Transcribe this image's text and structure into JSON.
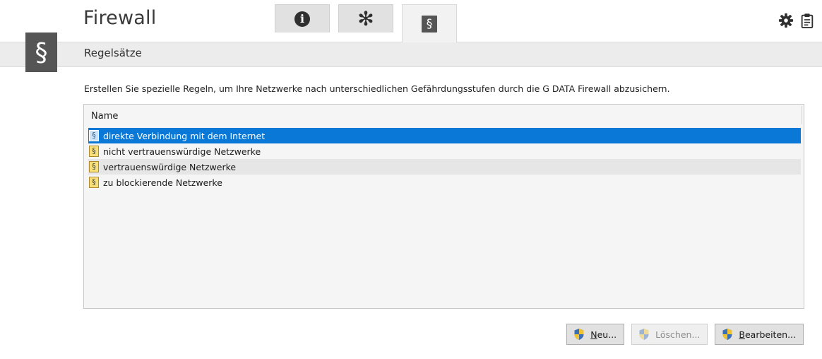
{
  "header": {
    "title": "Firewall",
    "tabs": [
      {
        "name": "info",
        "icon": "info-icon"
      },
      {
        "name": "settings",
        "icon": "asterisk-icon"
      },
      {
        "name": "rulesets",
        "icon": "paragraph-icon",
        "active": true
      }
    ],
    "top_icons": [
      "gear-icon",
      "clipboard-icon"
    ]
  },
  "section": {
    "badge_icon": "paragraph-icon",
    "title": "Regelsätze"
  },
  "description": "Erstellen Sie spezielle Regeln, um Ihre Netzwerke nach unterschiedlichen Gefährdungsstufen durch die G DATA Firewall abzusichern.",
  "list": {
    "column_header": "Name",
    "rows": [
      {
        "label": "direkte Verbindung mit dem Internet",
        "selected": true
      },
      {
        "label": "nicht vertrauenswürdige Netzwerke"
      },
      {
        "label": "vertrauenswürdige Netzwerke"
      },
      {
        "label": "zu blockierende Netzwerke"
      }
    ]
  },
  "buttons": {
    "new": {
      "mnemonic": "N",
      "rest": "eu..."
    },
    "delete": {
      "label": "Löschen...",
      "disabled": true
    },
    "edit": {
      "mnemonic": "B",
      "rest": "earbeiten..."
    }
  },
  "colors": {
    "selection": "#0a78d7",
    "badge": "#555555",
    "band": "#ececec"
  }
}
